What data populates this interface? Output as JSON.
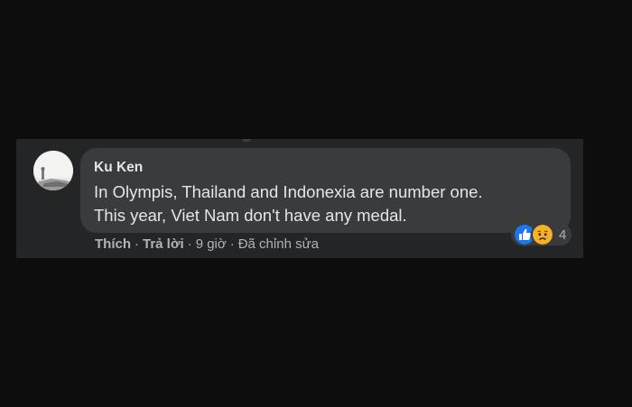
{
  "comment": {
    "author": "Ku Ken",
    "text_lines": [
      "In Olympis, Thailand and Indonexia are number one.",
      "This year, Viet Nam don't have any medal."
    ],
    "reactions": {
      "icons": [
        "like-icon",
        "sad-icon"
      ],
      "count": "4"
    },
    "actions": {
      "like_label": "Thích",
      "reply_label": "Trả lời",
      "timestamp": "9 giờ",
      "edited_label": "Đã chỉnh sửa",
      "separator": "·"
    }
  },
  "colors": {
    "page_bg": "#0d0d0e",
    "panel_bg": "#232526",
    "bubble_bg": "#3a3b3c",
    "primary_text": "#e4e6eb",
    "secondary_text": "#b0b3b8",
    "like_blue": "#1877f2",
    "sad_yellow": "#f7b125"
  }
}
